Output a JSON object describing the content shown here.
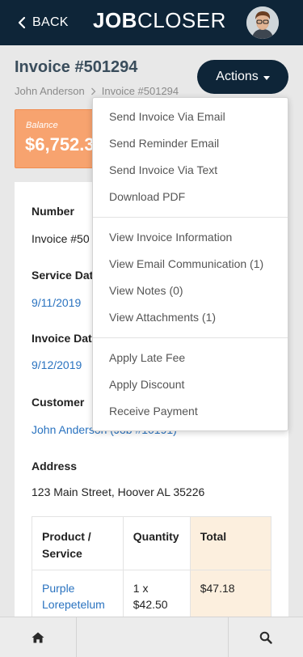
{
  "header": {
    "back_label": "BACK",
    "logo_bold": "JOB",
    "logo_light": "CLOSER"
  },
  "invoice": {
    "title": "Invoice #501294",
    "breadcrumb": [
      "John Anderson",
      "Invoice #501294"
    ],
    "actions_label": "Actions"
  },
  "balance": {
    "label": "Balance",
    "amount": "$6,752.3"
  },
  "details": {
    "number_label": "Number",
    "number_value": "Invoice #50",
    "service_date_label": "Service Dat",
    "service_date_value": "9/11/2019",
    "invoice_date_label": "Invoice Dat",
    "invoice_date_value": "9/12/2019",
    "customer_label": "Customer",
    "customer_link": "John Anderson",
    "customer_job": " (Job #10191)",
    "address_label": "Address",
    "address_value": "123 Main Street, Hoover AL 35226"
  },
  "table": {
    "headers": [
      "Product / Service",
      "Quantity",
      "Total"
    ],
    "rows": [
      {
        "product": "Purple Lorepetelum",
        "quantity": "1 x $42.50",
        "total": "$47.18"
      }
    ]
  },
  "actions_menu": {
    "groups": [
      [
        "Send Invoice Via Email",
        "Send Reminder Email",
        "Send Invoice Via Text",
        "Download PDF"
      ],
      [
        "View Invoice Information",
        "View Email Communication (1)",
        "View Notes (0)",
        "View Attachments (1)"
      ],
      [
        "Apply Late Fee",
        "Apply Discount",
        "Receive Payment"
      ]
    ]
  },
  "bottom_nav": {
    "icons": [
      "home-icon",
      "search-icon"
    ]
  },
  "colors": {
    "navy": "#0e2538",
    "balance_orange": "#f7a36f",
    "link_blue": "#2a73c0",
    "total_column_bg": "#fcefde"
  }
}
